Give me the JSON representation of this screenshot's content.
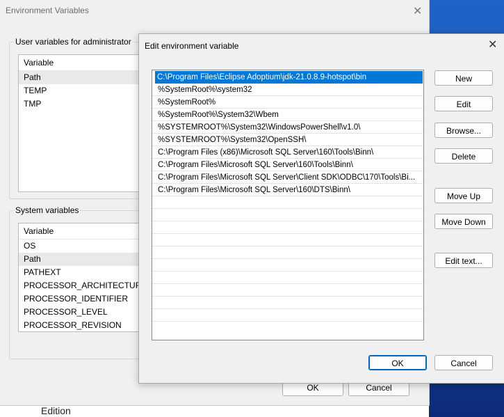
{
  "background_window": {
    "title": "Environment Variables",
    "user_group_label": "User variables for administrator",
    "user_vars": {
      "header": "Variable",
      "rows": [
        "Path",
        "TEMP",
        "TMP"
      ]
    },
    "system_group_label": "System variables",
    "system_vars": {
      "header": "Variable",
      "rows": [
        "OS",
        "Path",
        "PATHEXT",
        "PROCESSOR_ARCHITECTURE",
        "PROCESSOR_IDENTIFIER",
        "PROCESSOR_LEVEL",
        "PROCESSOR_REVISION"
      ]
    },
    "ok_label": "OK",
    "cancel_label": "Cancel"
  },
  "desktop": {
    "edition_text": "Edition"
  },
  "dialog": {
    "title": "Edit environment variable",
    "paths": [
      "C:\\Program Files\\Eclipse Adoptium\\jdk-21.0.8.9-hotspot\\bin",
      "%SystemRoot%\\system32",
      "%SystemRoot%",
      "%SystemRoot%\\System32\\Wbem",
      "%SYSTEMROOT%\\System32\\WindowsPowerShell\\v1.0\\",
      "%SYSTEMROOT%\\System32\\OpenSSH\\",
      "C:\\Program Files (x86)\\Microsoft SQL Server\\160\\Tools\\Binn\\",
      "C:\\Program Files\\Microsoft SQL Server\\160\\Tools\\Binn\\",
      "C:\\Program Files\\Microsoft SQL Server\\Client SDK\\ODBC\\170\\Tools\\Bi...",
      "C:\\Program Files\\Microsoft SQL Server\\160\\DTS\\Binn\\"
    ],
    "buttons": {
      "new": "New",
      "edit": "Edit",
      "browse": "Browse...",
      "delete": "Delete",
      "move_up": "Move Up",
      "move_down": "Move Down",
      "edit_text": "Edit text...",
      "ok": "OK",
      "cancel": "Cancel"
    }
  }
}
